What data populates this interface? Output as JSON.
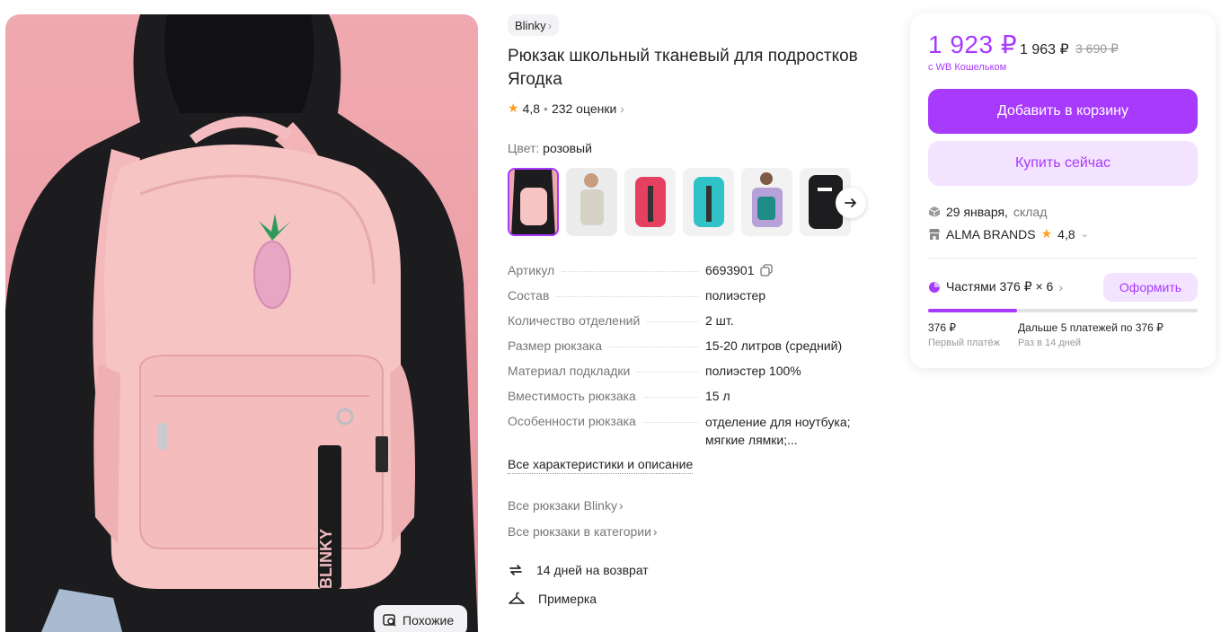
{
  "gallery": {
    "similar_label": "Похожие",
    "patch_text": "BLINKY"
  },
  "product": {
    "brand": "Blinky",
    "title": "Рюкзак школьный тканевый для подростков Ягодка",
    "rating": "4,8",
    "reviews": "232 оценки",
    "color_label": "Цвет:",
    "color_value": "розовый",
    "thumb_colors": [
      "#f2b9bf",
      "#d8d4cc",
      "#e5405f",
      "#2fc2c6",
      "#b8a0d8",
      "#1d1d1f"
    ]
  },
  "specs": [
    {
      "key": "Артикул",
      "value": "6693901"
    },
    {
      "key": "Состав",
      "value": "полиэстер"
    },
    {
      "key": "Количество отделений",
      "value": "2 шт."
    },
    {
      "key": "Размер рюкзака",
      "value": "15-20 литров (средний)"
    },
    {
      "key": "Материал подкладки",
      "value": "полиэстер 100%"
    },
    {
      "key": "Вместимость рюкзака",
      "value": "15 л"
    },
    {
      "key": "Особенности рюкзака",
      "value": "отделение для ноутбука; мягкие лямки;..."
    }
  ],
  "links": {
    "all_specs": "Все характеристики и описание",
    "all_brand": "Все рюкзаки Blinky",
    "all_category": "Все рюкзаки в категории"
  },
  "features": {
    "returns": "14 дней на возврат",
    "fitting": "Примерка"
  },
  "buy": {
    "price": "1 923 ₽",
    "price_alt": "1 963 ₽",
    "price_old": "3 690 ₽",
    "wallet_note": "с WB Кошельком",
    "add_to_cart": "Добавить в корзину",
    "buy_now": "Купить сейчас",
    "delivery_date": "29 января,",
    "delivery_place": "склад",
    "seller": "ALMA BRANDS",
    "seller_rating": "4,8",
    "installments": "Частями 376 ₽ × 6",
    "apply": "Оформить",
    "first_amount": "376 ₽",
    "first_label": "Первый платёж",
    "next_text": "Дальше 5 платежей по 376 ₽",
    "next_label": "Раз в 14 дней",
    "progress": 0.33,
    "accent": "#a73afd"
  }
}
